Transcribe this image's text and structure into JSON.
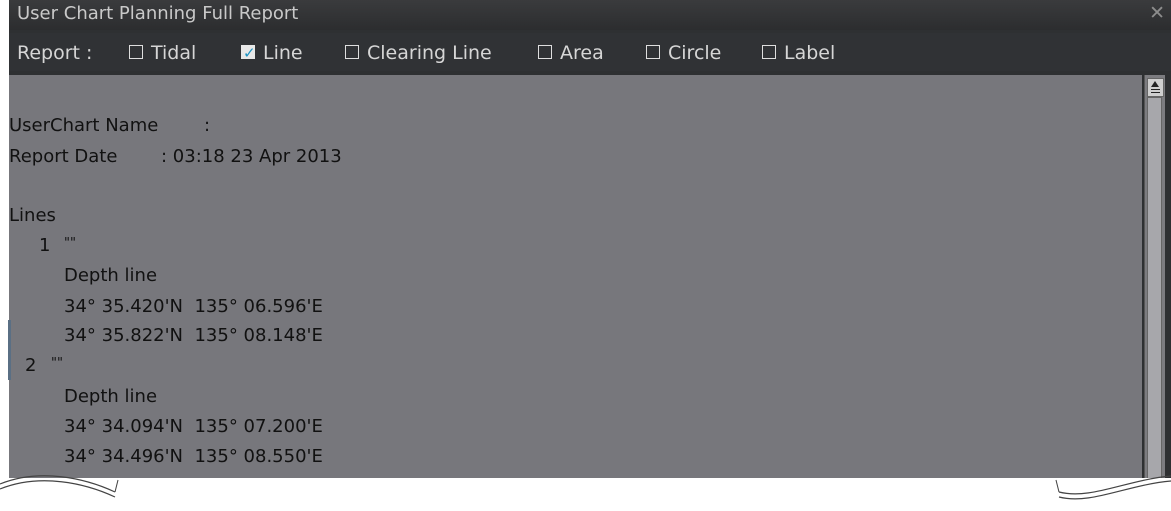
{
  "window": {
    "title": "User Chart Planning Full Report",
    "close_glyph": "✕"
  },
  "report_bar": {
    "label": "Report :",
    "options": [
      {
        "label": "Tidal",
        "checked": false
      },
      {
        "label": "Line",
        "checked": true
      },
      {
        "label": "Clearing Line",
        "checked": false
      },
      {
        "label": "Area",
        "checked": false
      },
      {
        "label": "Circle",
        "checked": false
      },
      {
        "label": "Label",
        "checked": false
      }
    ]
  },
  "report": {
    "userchart_name_label": "UserChart Name",
    "userchart_name_value": ":",
    "report_date_label": "Report Date",
    "report_date_value": ": 03:18 23 Apr 2013",
    "section_title": "Lines",
    "lines": [
      {
        "index": "1",
        "name": "\"\"",
        "type": "Depth line",
        "points": [
          "34° 35.420'N  135° 06.596'E",
          "34° 35.822'N  135° 08.148'E"
        ]
      },
      {
        "index": "2",
        "name": "\"\"",
        "type": "Depth line",
        "points": [
          "34° 34.094'N  135° 07.200'E",
          "34° 34.496'N  135° 08.550'E"
        ]
      }
    ]
  },
  "colors": {
    "accent_check": "#1d94c4",
    "content_bg": "#77777c",
    "window_bg": "#2e3032"
  }
}
